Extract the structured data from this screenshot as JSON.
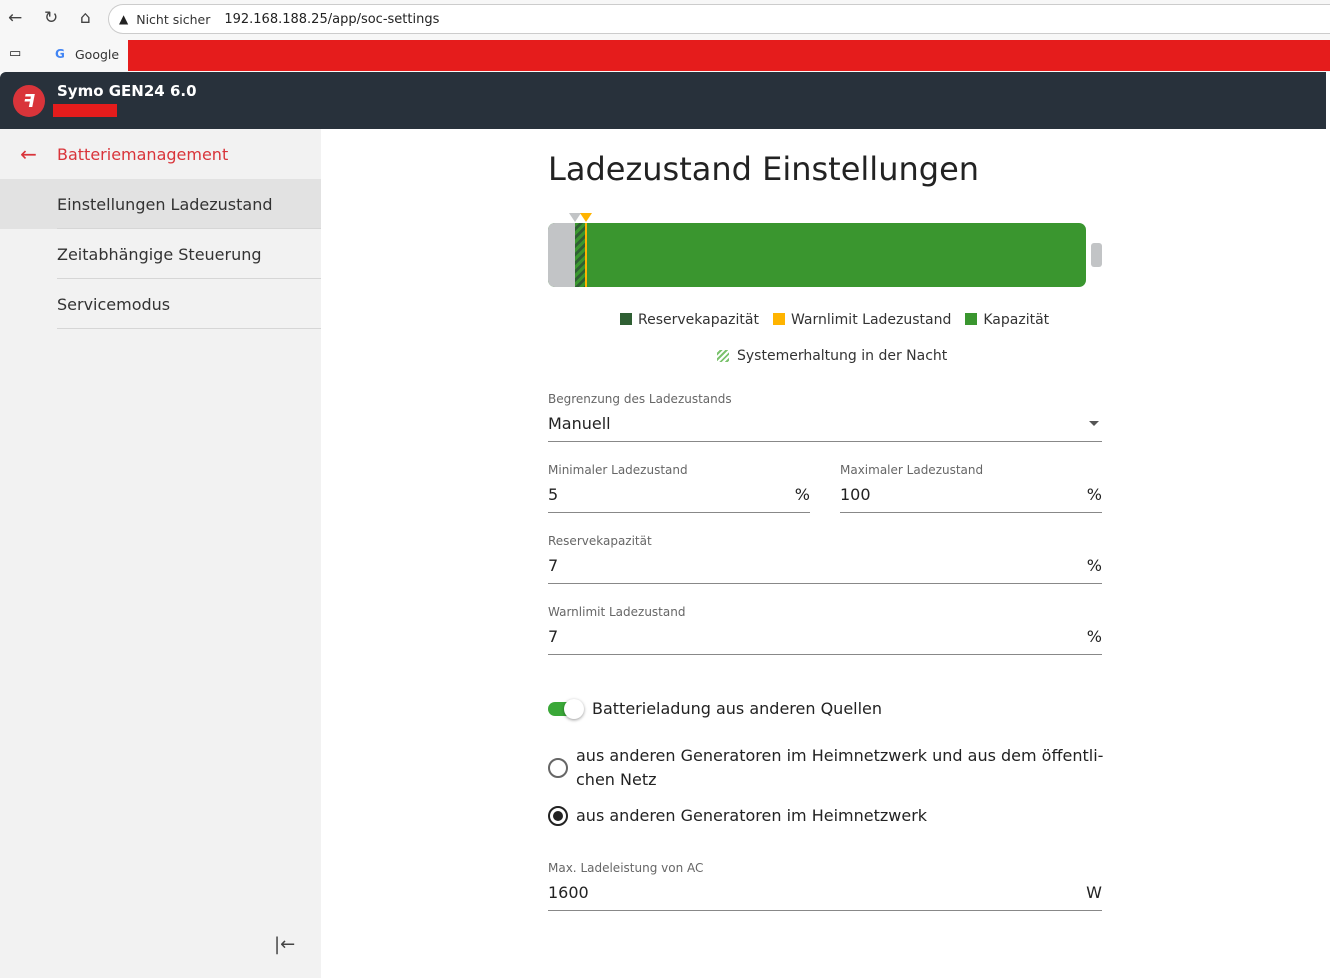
{
  "browser": {
    "security": "Nicht sicher",
    "url": "192.168.188.25/app/soc-settings",
    "bookmark": "Google"
  },
  "header": {
    "device_name": "Symo GEN24 6.0",
    "logo_text": "F"
  },
  "sidebar": {
    "back_label": "Batteriemanagement",
    "items": [
      {
        "label": "Einstellungen Ladezustand",
        "selected": true
      },
      {
        "label": "Zeitabhängige Steuerung"
      },
      {
        "label": "Servicemodus"
      }
    ]
  },
  "page": {
    "title": "Ladezustand Einstellungen"
  },
  "battery_bar": {
    "min_soc_percent": 5,
    "reserve_percent": 7,
    "warn_percent": 7,
    "max_percent": 100,
    "colors": {
      "reserve": "#2f5f33",
      "warn": "#ffb400",
      "capacity": "#3a962f",
      "empty": "#c2c4c6"
    }
  },
  "legend": {
    "reserve": "Reservekapazität",
    "warn": "Warnlimit Ladezustand",
    "capacity": "Kapazität",
    "night": "Systemerhaltung in der Nacht"
  },
  "form": {
    "limit": {
      "label": "Begrenzung des Ladezustands",
      "value": "Manuell"
    },
    "min_soc": {
      "label": "Minimaler Ladezustand",
      "value": "5",
      "unit": "%"
    },
    "max_soc": {
      "label": "Maximaler Ladezustand",
      "value": "100",
      "unit": "%"
    },
    "reserve": {
      "label": "Reservekapazität",
      "value": "7",
      "unit": "%"
    },
    "warn": {
      "label": "Warnlimit Ladezustand",
      "value": "7",
      "unit": "%"
    },
    "toggle": {
      "label": "Batterieladung aus anderen Quellen",
      "on": true
    },
    "radio1": {
      "label": "aus anderen Generatoren im Heimnetzwerk und aus dem öffentli-chen Netz",
      "line1": "aus anderen Generatoren im Heimnetzwerk und aus dem öffentli-",
      "line2": "chen Netz",
      "checked": false
    },
    "radio2": {
      "label": "aus anderen Generatoren im Heimnetzwerk",
      "checked": true
    },
    "ac_power": {
      "label": "Max. Ladeleistung von AC",
      "value": "1600",
      "unit": "W"
    }
  }
}
